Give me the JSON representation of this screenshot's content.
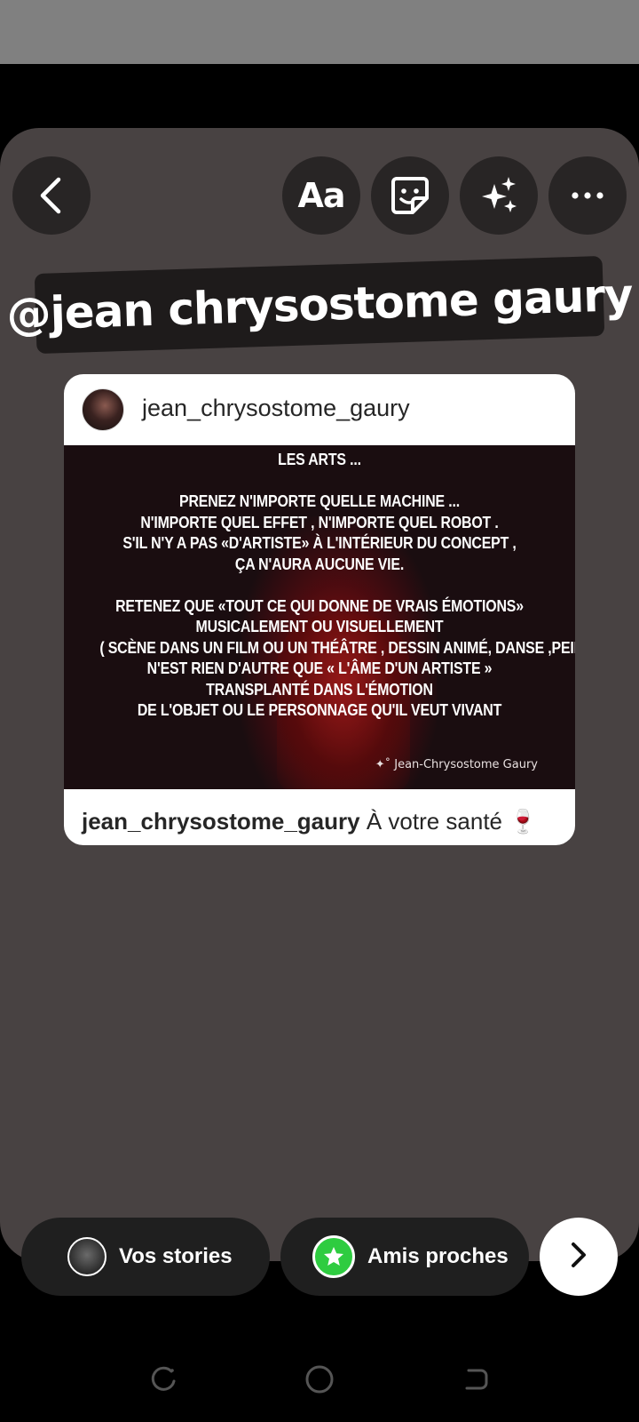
{
  "toolbar": {
    "back_icon": "chevron-left-icon",
    "text_label": "Aa",
    "sticker_icon": "sticker-icon",
    "effects_icon": "sparkles-icon",
    "more_icon": "more-horizontal-icon"
  },
  "mention": {
    "text": "@jean chrysostome gaury"
  },
  "post": {
    "username": "jean_chrysostome_gaury",
    "image_lines": [
      "LES ARTS ...",
      "",
      "PRENEZ N'IMPORTE QUELLE MACHINE ...",
      "N'IMPORTE QUEL EFFET , N'IMPORTE QUEL ROBOT .",
      "S'IL N'Y A PAS «D'ARTISTE» À L'INTÉRIEUR DU CONCEPT ,",
      "ÇA N'AURA AUCUNE VIE.",
      "",
      "RETENEZ QUE «TOUT CE QUI DONNE DE VRAIS ÉMOTIONS»",
      "MUSICALEMENT OU  VISUELLEMENT",
      "( SCÈNE DANS UN FILM OU UN THÉÂTRE , DESSIN ANIMÉ, DANSE ,PEINTURE ETC )",
      "N'EST RIEN D'AUTRE QUE « L'ÂME D'UN ARTISTE »",
      "TRANSPLANTÉ DANS L'ÉMOTION",
      "DE L'OBJET OU LE PERSONNAGE QU'IL VEUT VIVANT"
    ],
    "watermark": "✦˚ Jean-Chrysostome Gaury",
    "caption_user": "jean_chrysostome_gaury",
    "caption_text": " À votre santé 🍷"
  },
  "share": {
    "your_stories_label": "Vos stories",
    "close_friends_label": "Amis proches",
    "close_friends_color": "#2ecc40",
    "next_icon": "chevron-right-icon"
  },
  "nav": {
    "recents_icon": "recents-icon",
    "home_icon": "home-icon",
    "back_icon": "back-icon"
  }
}
